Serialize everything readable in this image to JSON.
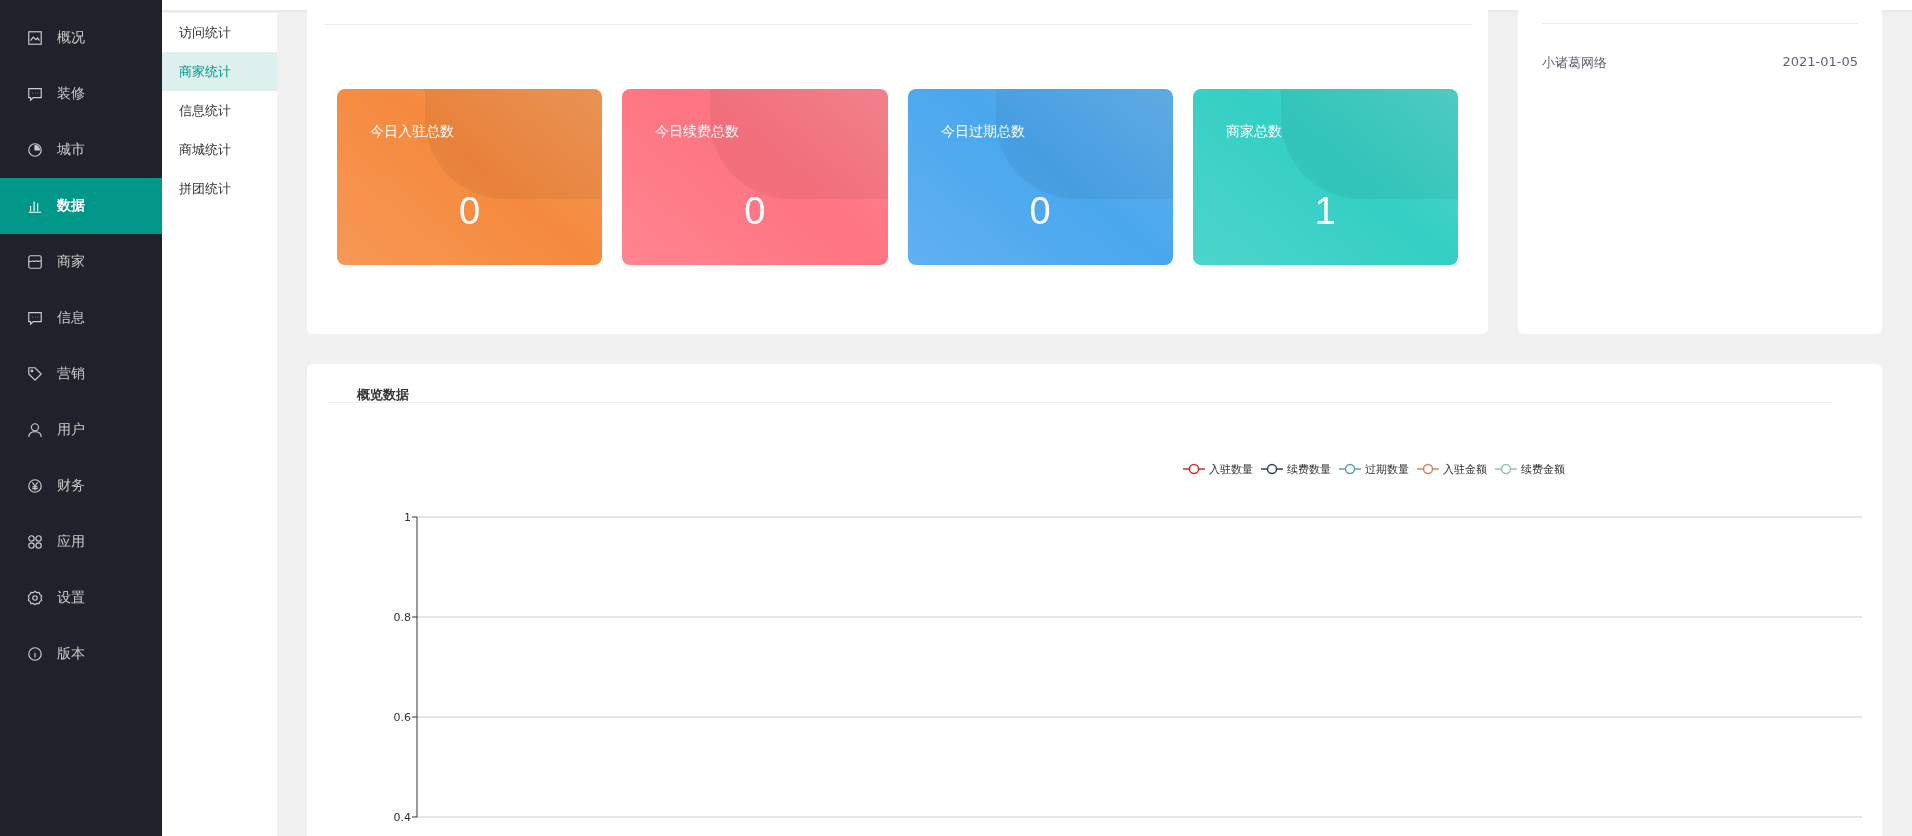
{
  "sidebar": {
    "items": [
      {
        "label": "概况",
        "selected": false
      },
      {
        "label": "装修",
        "selected": false
      },
      {
        "label": "城市",
        "selected": false
      },
      {
        "label": "数据",
        "selected": true
      },
      {
        "label": "商家",
        "selected": false
      },
      {
        "label": "信息",
        "selected": false
      },
      {
        "label": "营销",
        "selected": false
      },
      {
        "label": "用户",
        "selected": false
      },
      {
        "label": "财务",
        "selected": false
      },
      {
        "label": "应用",
        "selected": false
      },
      {
        "label": "设置",
        "selected": false
      },
      {
        "label": "版本",
        "selected": false
      }
    ]
  },
  "submenu": {
    "items": [
      {
        "label": "访问统计",
        "selected": false
      },
      {
        "label": "商家统计",
        "selected": true
      },
      {
        "label": "信息统计",
        "selected": false
      },
      {
        "label": "商城统计",
        "selected": false
      },
      {
        "label": "拼团统计",
        "selected": false
      }
    ]
  },
  "stat_cards": [
    {
      "label": "今日入驻总数",
      "value": "0",
      "color": "#f58a3e"
    },
    {
      "label": "今日续费总数",
      "value": "0",
      "color": "#fe7481"
    },
    {
      "label": "今日过期总数",
      "value": "0",
      "color": "#4aa7ee"
    },
    {
      "label": "商家总数",
      "value": "1",
      "color": "#34cfc4"
    }
  ],
  "recent_list": {
    "rows": [
      {
        "name": "小诸葛网络",
        "date": "2021-01-05"
      }
    ]
  },
  "overview": {
    "title": "概览数据",
    "chart_data": {
      "type": "line",
      "ylim": [
        0.4,
        1
      ],
      "grid": true,
      "yticks": [
        0.4,
        0.6,
        0.8,
        1
      ],
      "series": [
        {
          "name": "入驻数量",
          "color": "#c23531"
        },
        {
          "name": "续费数量",
          "color": "#2f4554"
        },
        {
          "name": "过期数量",
          "color": "#61a0a8"
        },
        {
          "name": "入驻金额",
          "color": "#d48265"
        },
        {
          "name": "续费金额",
          "color": "#91c7ae"
        }
      ]
    }
  }
}
